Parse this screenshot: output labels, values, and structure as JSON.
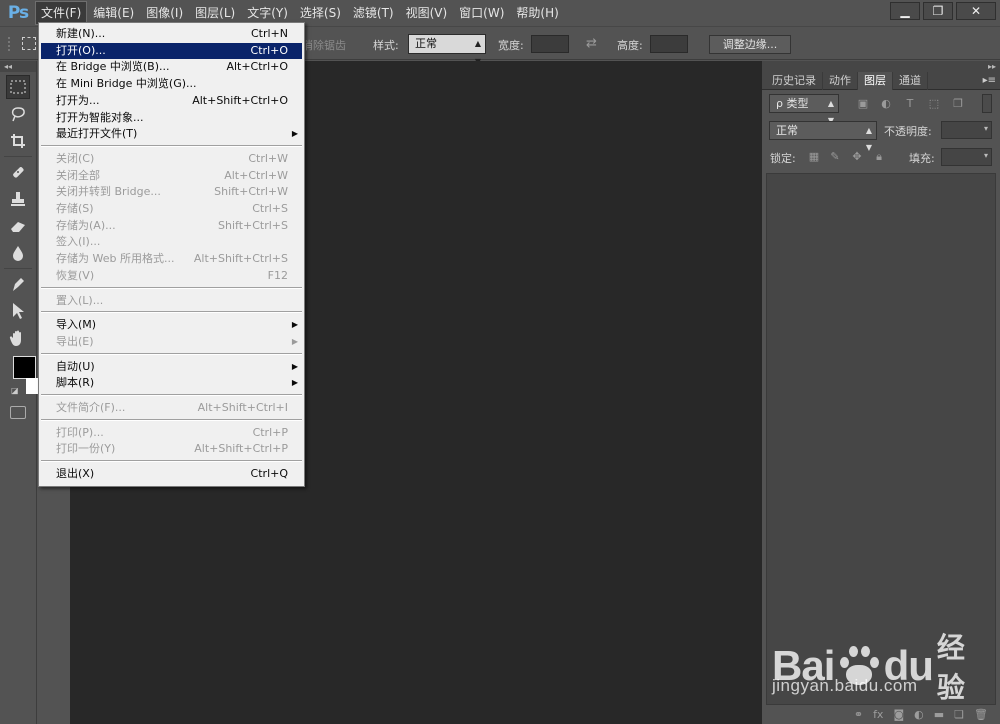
{
  "app": {
    "logo": "Ps"
  },
  "menubar": {
    "items": [
      "文件(F)",
      "编辑(E)",
      "图像(I)",
      "图层(L)",
      "文字(Y)",
      "选择(S)",
      "滤镜(T)",
      "视图(V)",
      "窗口(W)",
      "帮助(H)"
    ],
    "active_index": 0
  },
  "window_controls": {
    "minimize": "▁",
    "restore": "❐",
    "close": "✕"
  },
  "options_bar": {
    "antialias_label": "消除锯齿",
    "style_label": "样式:",
    "style_value": "正常",
    "width_label": "宽度:",
    "height_label": "高度:",
    "refine_edge_button": "调整边缘..."
  },
  "file_menu": {
    "groups": [
      [
        {
          "label": "新建(N)...",
          "shortcut": "Ctrl+N",
          "disabled": false,
          "highlighted": false,
          "submenu": false
        },
        {
          "label": "打开(O)...",
          "shortcut": "Ctrl+O",
          "disabled": false,
          "highlighted": true,
          "submenu": false
        },
        {
          "label": "在 Bridge 中浏览(B)...",
          "shortcut": "Alt+Ctrl+O",
          "disabled": false,
          "highlighted": false,
          "submenu": false
        },
        {
          "label": "在 Mini Bridge 中浏览(G)...",
          "shortcut": "",
          "disabled": false,
          "highlighted": false,
          "submenu": false
        },
        {
          "label": "打开为...",
          "shortcut": "Alt+Shift+Ctrl+O",
          "disabled": false,
          "highlighted": false,
          "submenu": false
        },
        {
          "label": "打开为智能对象...",
          "shortcut": "",
          "disabled": false,
          "highlighted": false,
          "submenu": false
        },
        {
          "label": "最近打开文件(T)",
          "shortcut": "",
          "disabled": false,
          "highlighted": false,
          "submenu": true
        }
      ],
      [
        {
          "label": "关闭(C)",
          "shortcut": "Ctrl+W",
          "disabled": true,
          "highlighted": false,
          "submenu": false
        },
        {
          "label": "关闭全部",
          "shortcut": "Alt+Ctrl+W",
          "disabled": true,
          "highlighted": false,
          "submenu": false
        },
        {
          "label": "关闭并转到 Bridge...",
          "shortcut": "Shift+Ctrl+W",
          "disabled": true,
          "highlighted": false,
          "submenu": false
        },
        {
          "label": "存储(S)",
          "shortcut": "Ctrl+S",
          "disabled": true,
          "highlighted": false,
          "submenu": false
        },
        {
          "label": "存储为(A)...",
          "shortcut": "Shift+Ctrl+S",
          "disabled": true,
          "highlighted": false,
          "submenu": false
        },
        {
          "label": "签入(I)...",
          "shortcut": "",
          "disabled": true,
          "highlighted": false,
          "submenu": false
        },
        {
          "label": "存储为 Web 所用格式...",
          "shortcut": "Alt+Shift+Ctrl+S",
          "disabled": true,
          "highlighted": false,
          "submenu": false
        },
        {
          "label": "恢复(V)",
          "shortcut": "F12",
          "disabled": true,
          "highlighted": false,
          "submenu": false
        }
      ],
      [
        {
          "label": "置入(L)...",
          "shortcut": "",
          "disabled": true,
          "highlighted": false,
          "submenu": false
        }
      ],
      [
        {
          "label": "导入(M)",
          "shortcut": "",
          "disabled": false,
          "highlighted": false,
          "submenu": true
        },
        {
          "label": "导出(E)",
          "shortcut": "",
          "disabled": true,
          "highlighted": false,
          "submenu": true
        }
      ],
      [
        {
          "label": "自动(U)",
          "shortcut": "",
          "disabled": false,
          "highlighted": false,
          "submenu": true
        },
        {
          "label": "脚本(R)",
          "shortcut": "",
          "disabled": false,
          "highlighted": false,
          "submenu": true
        }
      ],
      [
        {
          "label": "文件简介(F)...",
          "shortcut": "Alt+Shift+Ctrl+I",
          "disabled": true,
          "highlighted": false,
          "submenu": false
        }
      ],
      [
        {
          "label": "打印(P)...",
          "shortcut": "Ctrl+P",
          "disabled": true,
          "highlighted": false,
          "submenu": false
        },
        {
          "label": "打印一份(Y)",
          "shortcut": "Alt+Shift+Ctrl+P",
          "disabled": true,
          "highlighted": false,
          "submenu": false
        }
      ],
      [
        {
          "label": "退出(X)",
          "shortcut": "Ctrl+Q",
          "disabled": false,
          "highlighted": false,
          "submenu": false
        }
      ]
    ]
  },
  "tools": [
    "rect-marquee-icon",
    "lasso-icon",
    "crop-icon",
    "healing-brush-icon",
    "stamp-icon",
    "eraser-icon",
    "blur-drop-icon",
    "pen-icon",
    "path-select-icon",
    "hand-icon"
  ],
  "panel": {
    "tabs": [
      "历史记录",
      "动作",
      "图层",
      "通道"
    ],
    "active_tab": 2,
    "filter_kind": "ρ 类型",
    "blend_mode": "正常",
    "opacity_label": "不透明度:",
    "lock_label": "锁定:",
    "fill_label": "填充:"
  },
  "watermark": {
    "brand_left": "Bai",
    "brand_right": "du",
    "brand_cn": "经验",
    "url": "jingyan.baidu.com"
  },
  "colors": {
    "ui_bg": "#535353",
    "canvas_bg": "#282828",
    "menu_bg": "#f0f0f0",
    "menu_highlight": "#0a246a",
    "logo_blue": "#6ab0e6"
  }
}
